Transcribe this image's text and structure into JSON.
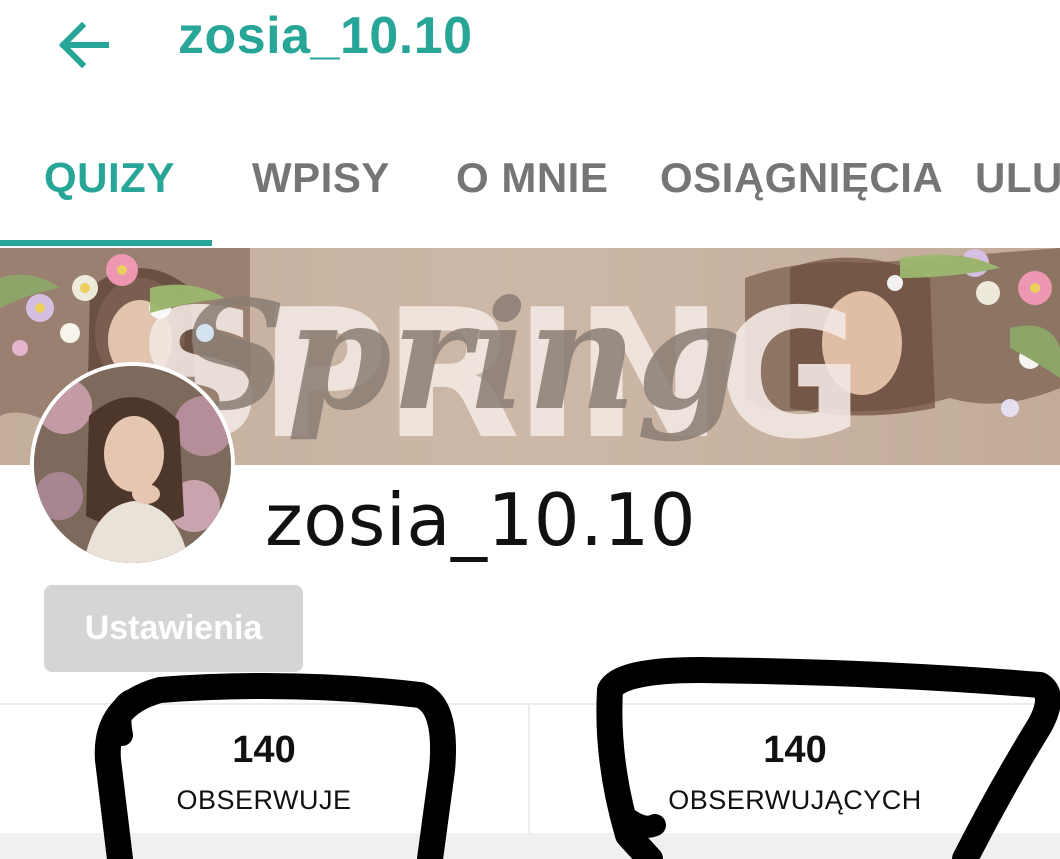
{
  "header": {
    "title": "zosia_10.10",
    "back_icon": "arrow-left-icon"
  },
  "tabs": [
    {
      "label": "QUIZY",
      "active": true
    },
    {
      "label": "WPISY",
      "active": false
    },
    {
      "label": "O MNIE",
      "active": false
    },
    {
      "label": "OSIĄGNIĘCIA",
      "active": false
    },
    {
      "label": "ULUBIONE",
      "active": false
    }
  ],
  "banner": {
    "text_block": "SPRING",
    "text_script": "Spring"
  },
  "profile": {
    "name": "zosia_10.10",
    "settings_label": "Ustawienia"
  },
  "stats": {
    "following": {
      "value": "140",
      "label": "OBSERWUJE"
    },
    "followers": {
      "value": "140",
      "label": "OBSERWUJĄCYCH"
    }
  },
  "colors": {
    "accent": "#27a697",
    "tab_inactive": "#757575",
    "button_disabled": "#d5d5d5"
  }
}
